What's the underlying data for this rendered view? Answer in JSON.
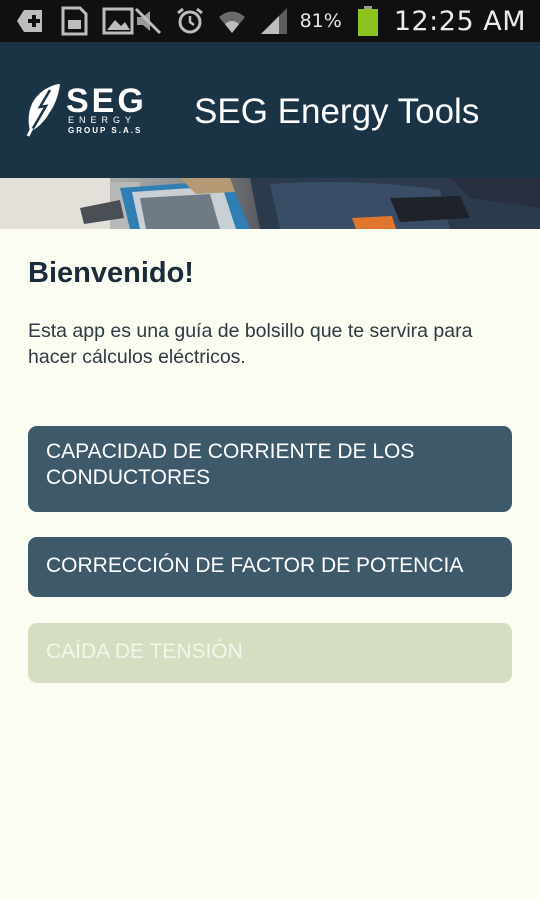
{
  "status_bar": {
    "battery_percent": "81%",
    "time": "12:25 AM",
    "icons": [
      "plus-icon",
      "sd-card-icon",
      "image-icon",
      "mute-icon",
      "alarm-icon",
      "wifi-icon",
      "signal-icon",
      "battery-icon"
    ]
  },
  "header": {
    "logo_name": "SEG",
    "logo_sub1": "ENERGY",
    "logo_sub2": "GROUP S.A.S",
    "app_title": "SEG Energy Tools"
  },
  "main": {
    "welcome": "Bienvenido!",
    "description": "Esta app es una guía de bolsillo que te servira para hacer cálculos eléctricos.",
    "buttons": [
      {
        "label": "CAPACIDAD DE CORRIENTE DE LOS CONDUCTORES",
        "color": "#3e5a6a"
      },
      {
        "label": "CORRECCIÓN DE FACTOR DE POTENCIA",
        "color": "#3e5a6a"
      },
      {
        "label": "CAÍDA DE TENSIÓN",
        "color": "#d6dec2"
      }
    ]
  },
  "colors": {
    "header_bg": "#1b3445",
    "page_bg": "#fbfdf3",
    "status_bar_bg": "#101010"
  }
}
